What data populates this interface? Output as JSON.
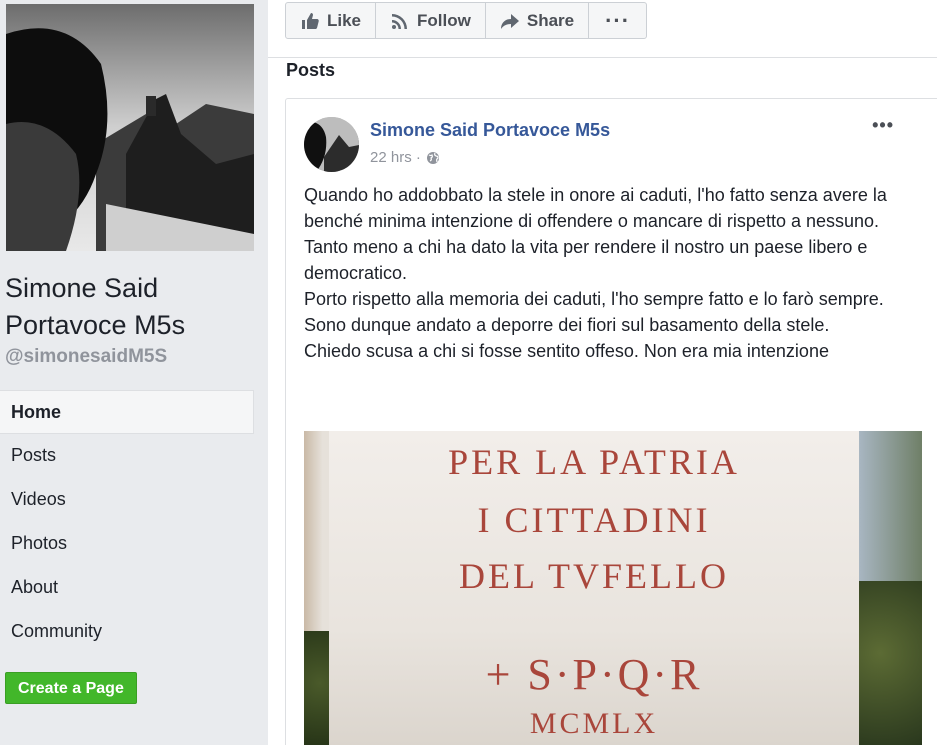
{
  "page": {
    "name": "Simone Said Portavoce M5s",
    "handle": "@simonesaidM5S"
  },
  "nav": {
    "items": [
      {
        "label": "Home",
        "active": true
      },
      {
        "label": "Posts",
        "active": false
      },
      {
        "label": "Videos",
        "active": false
      },
      {
        "label": "Photos",
        "active": false
      },
      {
        "label": "About",
        "active": false
      },
      {
        "label": "Community",
        "active": false
      }
    ]
  },
  "create_page_label": "Create a Page",
  "actions": {
    "like": "Like",
    "follow": "Follow",
    "share": "Share",
    "more": "···"
  },
  "posts_heading": "Posts",
  "post": {
    "author": "Simone Said Portavoce M5s",
    "time": "22 hrs ·",
    "menu": "•••",
    "lines": [
      "Quando ho addobbato la stele in onore ai caduti, l'ho fatto senza avere la benché minima intenzione di offendere o mancare di rispetto a nessuno.",
      "Tanto meno a chi ha dato la vita per rendere il nostro un paese libero e democratico.",
      "Porto rispetto alla memoria dei caduti, l'ho sempre fatto e lo farò sempre.",
      "Sono dunque andato a deporre dei fiori sul basamento della stele.",
      "Chiedo scusa a chi si fosse sentito offeso. Non era mia intenzione"
    ],
    "image_inscription": [
      "PER LA PATRIA",
      "I CITTADINI",
      "DEL TVFELLO",
      "+ S·P·Q·R",
      "MCMLX"
    ]
  },
  "colors": {
    "link": "#365899",
    "create_button": "#42b72a",
    "page_bg": "#e9ebee"
  },
  "icons": [
    "like-icon",
    "follow-icon",
    "share-icon",
    "more-icon",
    "globe-icon",
    "post-menu-icon"
  ]
}
